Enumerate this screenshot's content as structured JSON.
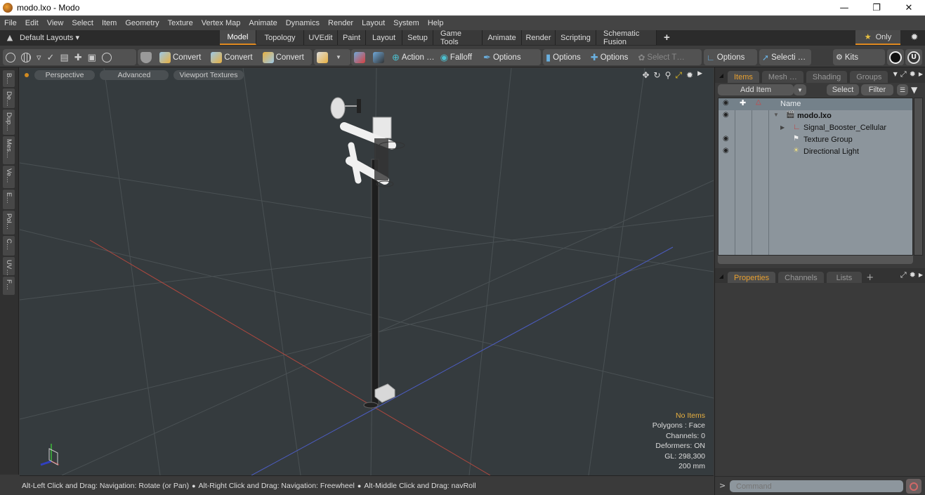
{
  "window": {
    "title": "modo.lxo - Modo",
    "minimize_icon": "minimize-icon",
    "restore_icon": "restore-icon",
    "close_icon": "close-icon"
  },
  "menu": [
    "File",
    "Edit",
    "View",
    "Select",
    "Item",
    "Geometry",
    "Texture",
    "Vertex Map",
    "Animate",
    "Dynamics",
    "Render",
    "Layout",
    "System",
    "Help"
  ],
  "layout_bar": {
    "layouts_label": "Default Layouts ▾",
    "tabs": [
      {
        "label": "Model",
        "active": true
      },
      {
        "label": "Topology"
      },
      {
        "label": "UVEdit"
      },
      {
        "label": "Paint"
      },
      {
        "label": "Layout"
      },
      {
        "label": "Setup"
      },
      {
        "label": "Game Tools"
      },
      {
        "label": "Animate"
      },
      {
        "label": "Render"
      },
      {
        "label": "Scripting"
      },
      {
        "label": "Schematic Fusion"
      }
    ],
    "add_tab": "+",
    "only_label": "Only"
  },
  "toolbar": {
    "convert1": "Convert",
    "convert2": "Convert",
    "convert3": "Convert",
    "action": "Action …",
    "falloff": "Falloff",
    "options1": "Options",
    "options2": "Options",
    "options3": "Options",
    "select_t": "Select T…",
    "options4": "Options",
    "selecti": "Selecti …",
    "kits": "Kits"
  },
  "side_tabs": [
    "B…",
    "De…",
    "Dup…",
    "Mes…",
    "Ve…",
    "E…",
    "Pol…",
    "C…",
    "UV…",
    "F…"
  ],
  "viewport": {
    "view_mode": "Perspective",
    "shading": "Advanced",
    "textures": "Viewport Textures",
    "info": {
      "selection": "No Items",
      "polygons": "Polygons : Face",
      "channels": "Channels: 0",
      "deformers": "Deformers: ON",
      "gl": "GL: 298,300",
      "scale": "200 mm"
    }
  },
  "status_bar": {
    "hint1": "Alt-Left Click and Drag: Navigation: Rotate (or Pan)",
    "hint2": "Alt-Right Click and Drag: Navigation: Freewheel",
    "hint3": "Alt-Middle Click and Drag: navRoll"
  },
  "items_panel": {
    "tabs": [
      {
        "label": "Items",
        "active": true
      },
      {
        "label": "Mesh …"
      },
      {
        "label": "Shading"
      },
      {
        "label": "Groups"
      }
    ],
    "add_item": "Add Item",
    "select": "Select",
    "filter": "Filter",
    "name_header": "Name",
    "rows": [
      {
        "name": "modo.lxo",
        "visible": true,
        "icon": "scene-icon",
        "expanded": true
      },
      {
        "name": "Signal_Booster_Cellular",
        "visible": false,
        "icon": "locator-icon",
        "expandable": true
      },
      {
        "name": "Texture Group",
        "visible": true,
        "icon": "texture-group-icon"
      },
      {
        "name": "Directional Light",
        "visible": true,
        "icon": "directional-light-icon"
      }
    ]
  },
  "properties_panel": {
    "tabs": [
      {
        "label": "Properties",
        "active": true
      },
      {
        "label": "Channels"
      },
      {
        "label": "Lists"
      }
    ],
    "add_tab": "+"
  },
  "command": {
    "prompt": ">",
    "placeholder": "Command"
  }
}
